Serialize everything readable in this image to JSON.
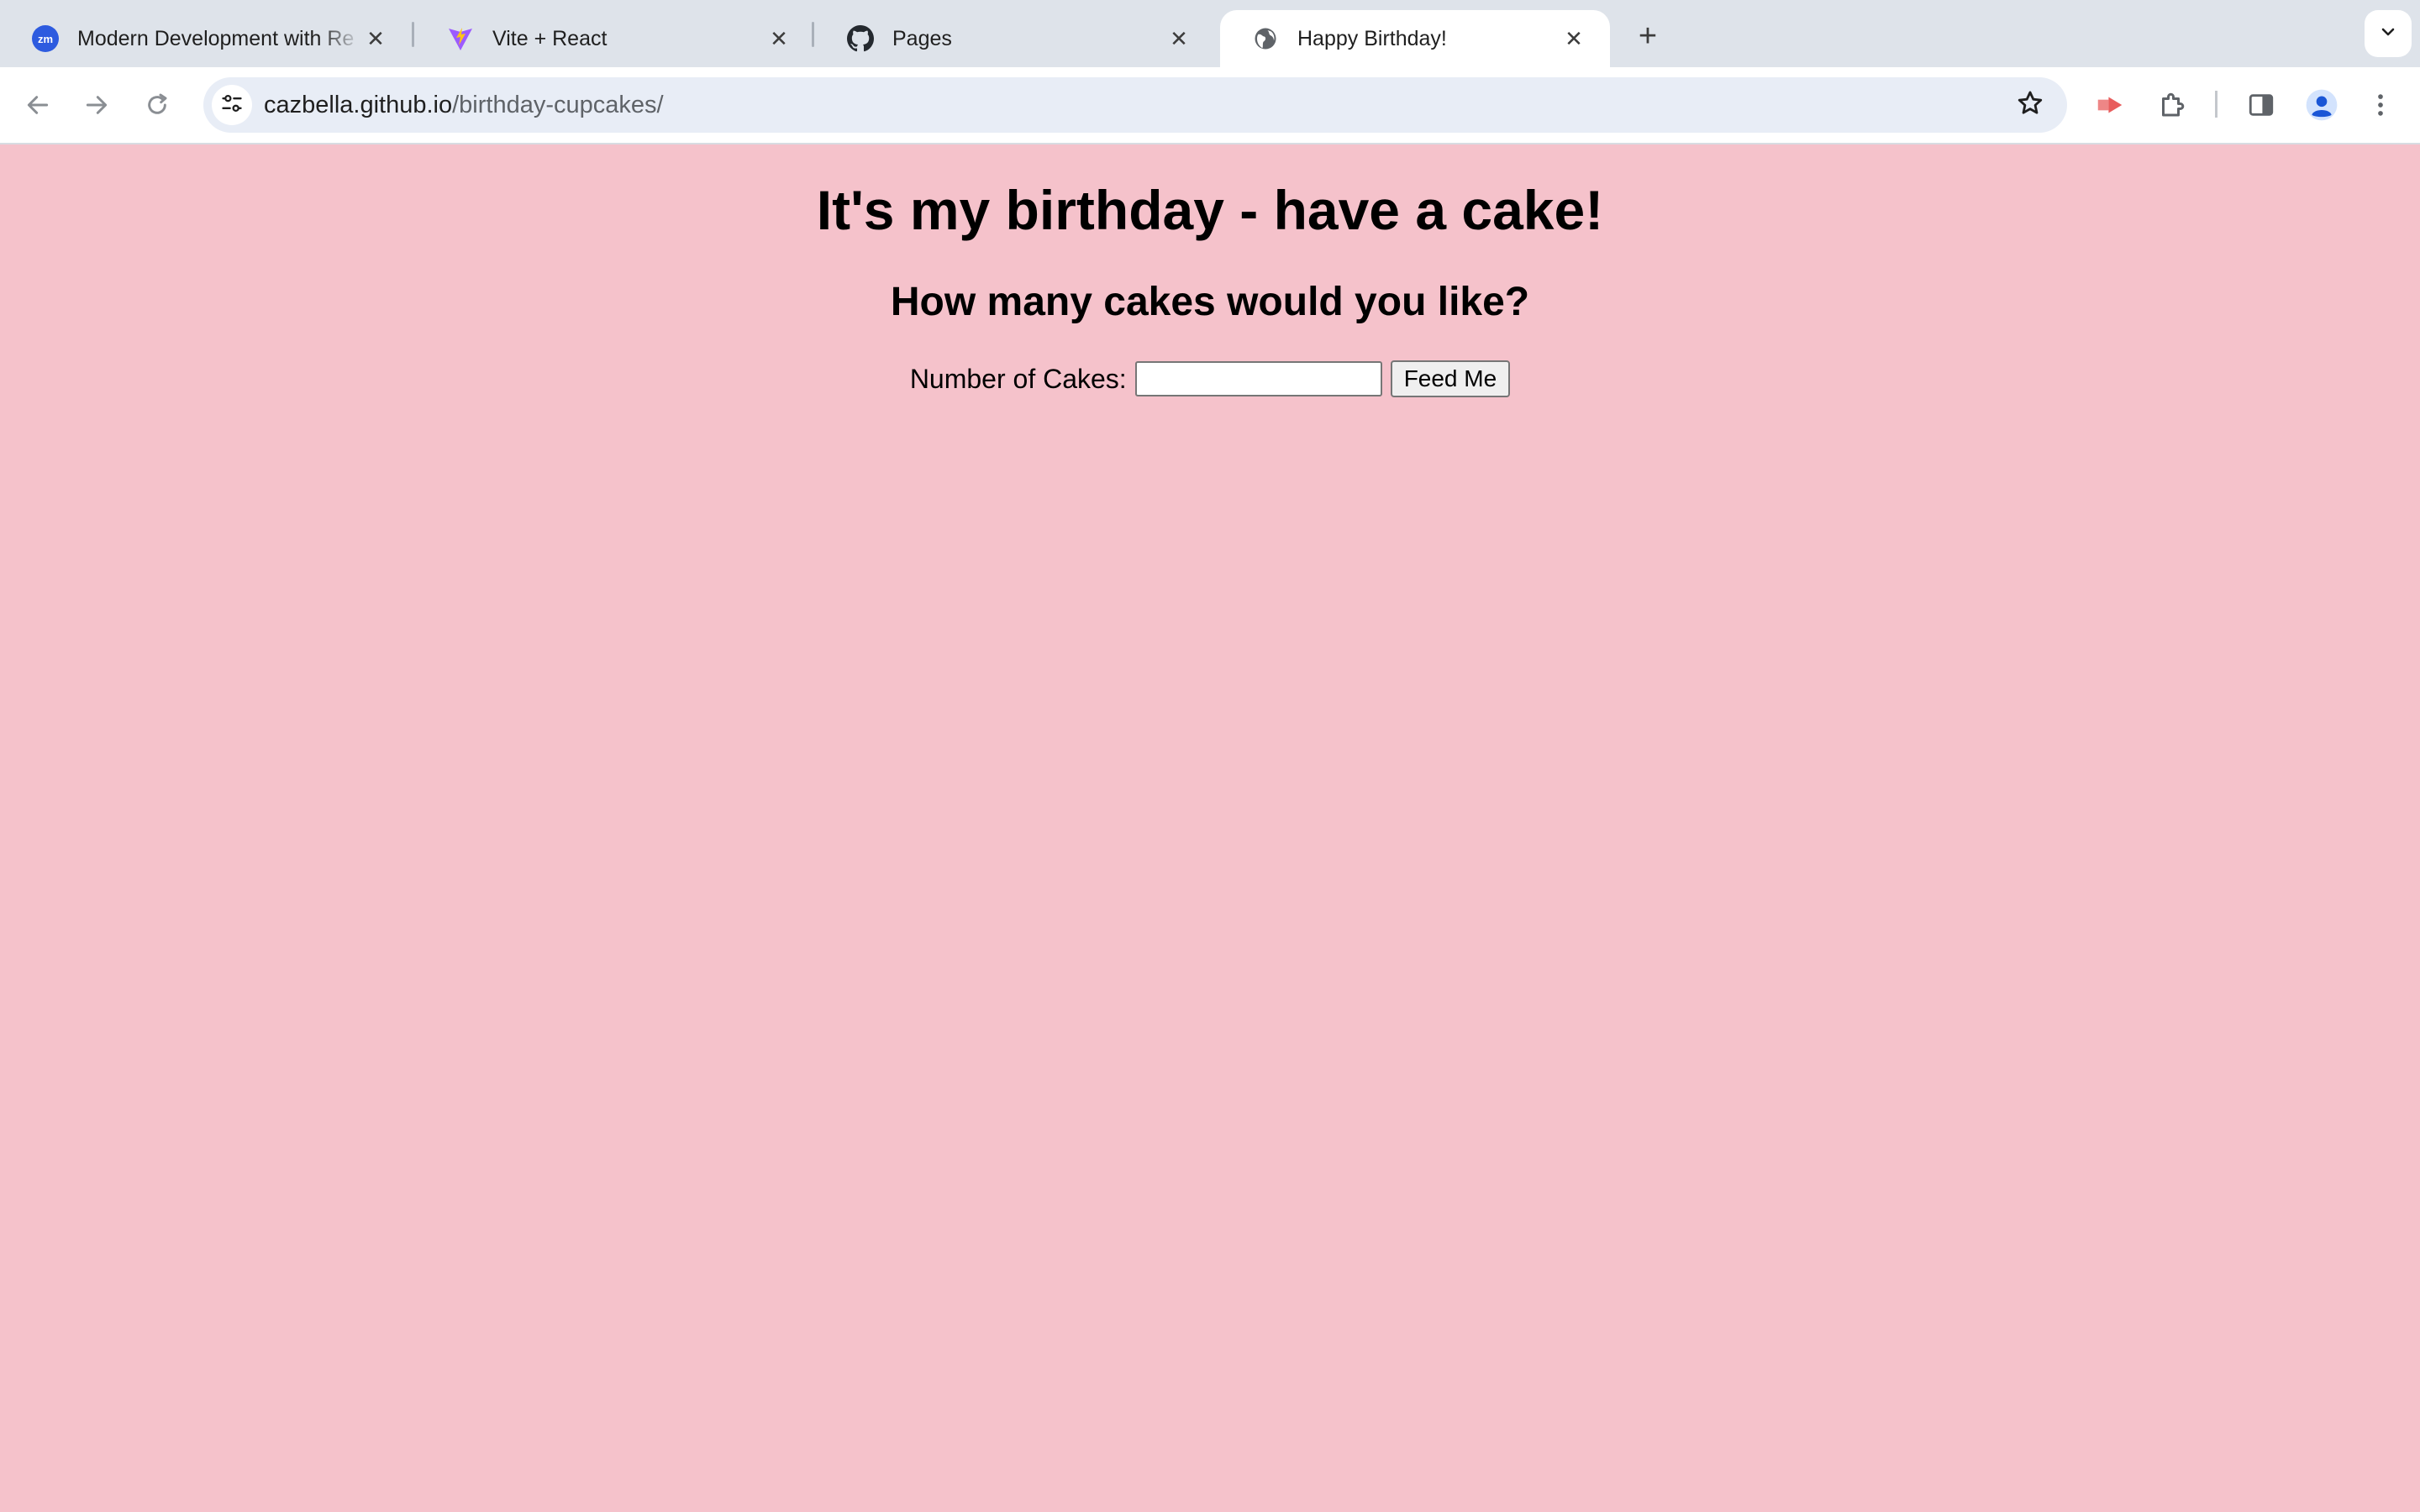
{
  "browser": {
    "tabs": [
      {
        "title": "Modern Development with Re",
        "favicon": "zoom-app-icon",
        "active": false
      },
      {
        "title": "Vite + React",
        "favicon": "vite-logo-icon",
        "active": false
      },
      {
        "title": "Pages",
        "favicon": "github-icon",
        "active": false
      },
      {
        "title": "Happy Birthday!",
        "favicon": "globe-icon",
        "active": true
      }
    ],
    "zoom_favicon_text": "zm",
    "close_glyph": "✕",
    "newtab_glyph": "+",
    "url": {
      "host": "cazbella.github.io",
      "path": "/birthday-cupcakes/"
    }
  },
  "page": {
    "heading": "It's my birthday - have a cake!",
    "subheading": "How many cakes would you like?",
    "form": {
      "label": "Number of Cakes:",
      "input_value": "",
      "button_label": "Feed Me"
    }
  },
  "colors": {
    "page_background": "#f5c2cb",
    "tabstrip_background": "#dee3ea",
    "omnibox_background": "#e8edf6",
    "zoom_blue": "#2d5bdf",
    "vite_purple": "#9c5bff",
    "vite_yellow": "#ffc517",
    "cast_red": "#e85d5d",
    "profile_blue": "#1a56d6"
  }
}
